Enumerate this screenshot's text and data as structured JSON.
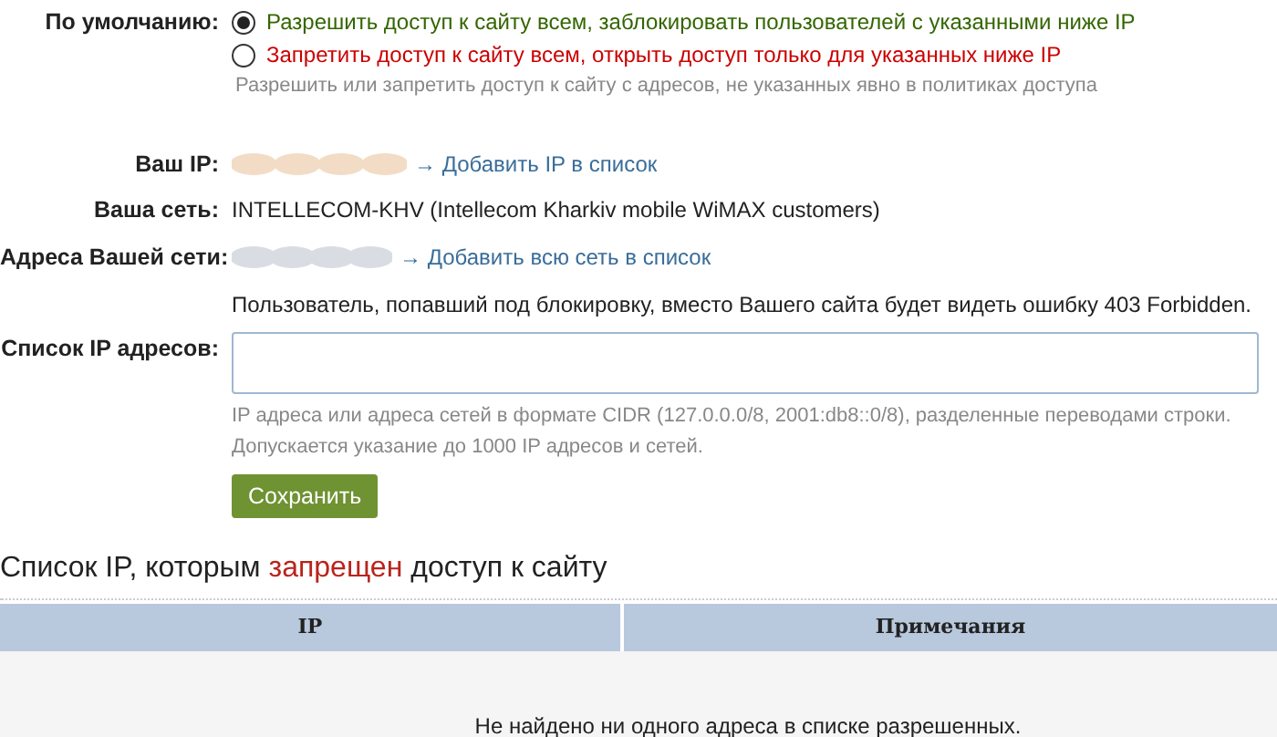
{
  "default_policy": {
    "label": "По умолчанию:",
    "options": [
      {
        "label": "Разрешить доступ к сайту всем, заблокировать пользователей с указанными ниже IP",
        "selected": true,
        "color": "#336600"
      },
      {
        "label": "Запретить доступ к сайту всем, открыть доступ только для указанных ниже IP",
        "selected": false,
        "color": "#cc0000"
      }
    ],
    "hint": "Разрешить или запретить доступ к сайту с адресов, не указанных явно в политиках доступа"
  },
  "your_ip": {
    "label": "Ваш IP:",
    "link": "→ Добавить IP в список"
  },
  "your_network": {
    "label": "Ваша сеть:",
    "value": "INTELLECOM-KHV (Intellecom Kharkiv mobile WiMAX customers)"
  },
  "network_addresses": {
    "label": "Адреса Вашей сети:",
    "link": "→ Добавить всю сеть в список"
  },
  "block_note": "Пользователь, попавший под блокировку, вместо Вашего сайта будет видеть ошибку 403 Forbidden.",
  "ip_list": {
    "label": "Список IP адресов:",
    "hints": [
      "IP адреса или адреса сетей в формате CIDR (127.0.0.0/8, 2001:db8::0/8), разделенные переводами строки.",
      "Допускается указание до 1000 IP адресов и сетей."
    ]
  },
  "save_button": "Сохранить",
  "section_title": {
    "before": "Список IP, которым ",
    "highlight": "запрещен",
    "after": " доступ к сайту"
  },
  "table": {
    "columns": [
      "IP",
      "Примечания"
    ],
    "empty_message": "Не найдено ни одного адреса в списке разрешенных."
  }
}
